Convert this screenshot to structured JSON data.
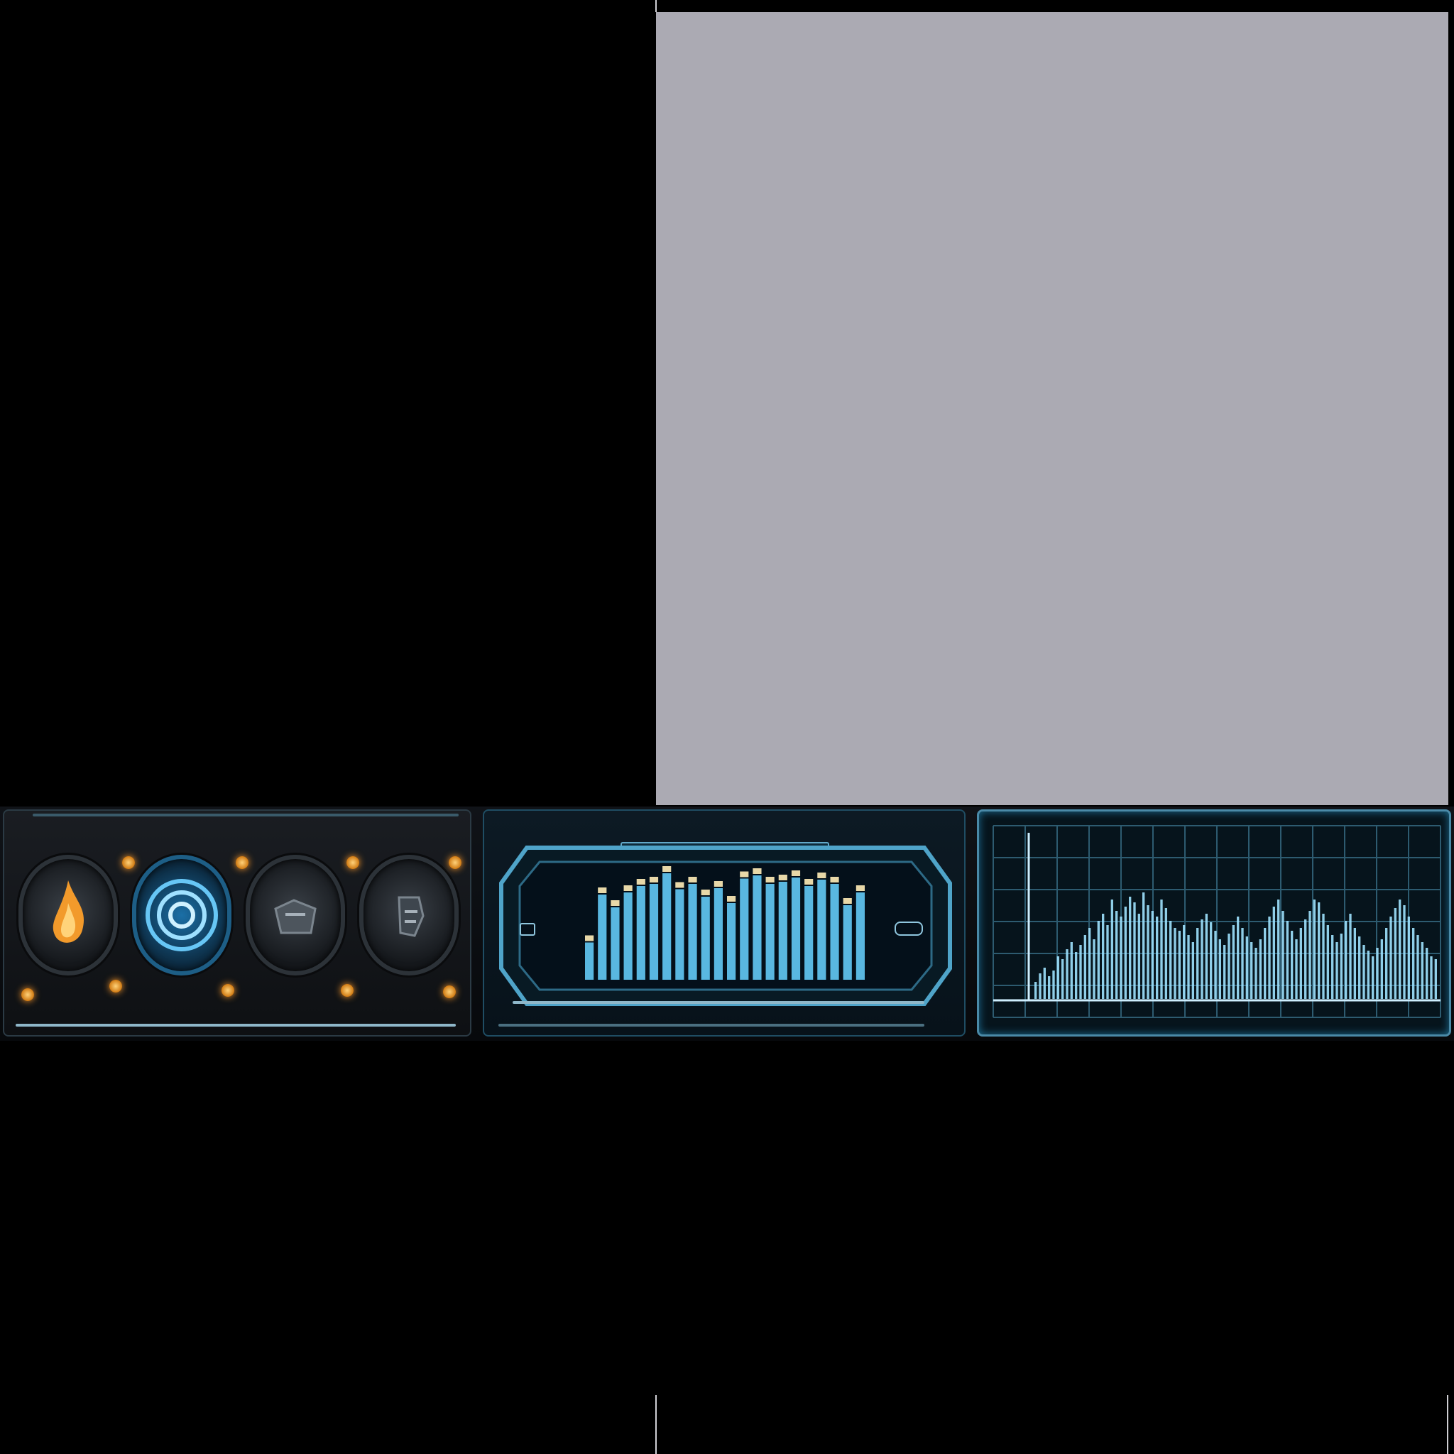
{
  "scene": {
    "background_color": "#000000",
    "viewport_color": "#abaab3"
  },
  "hud": {
    "ability_slots": [
      {
        "name": "fire",
        "icon": "flame-icon",
        "accent": "#ff9a2a"
      },
      {
        "name": "water",
        "icon": "spiral-icon",
        "accent": "#3aa6e8"
      },
      {
        "name": "beast",
        "icon": "claw-icon",
        "accent": "#6e7780"
      },
      {
        "name": "rune",
        "icon": "rune-icon",
        "accent": "#6e7780"
      }
    ],
    "equalizer": {
      "title": "",
      "bar_levels": [
        0.35,
        0.8,
        0.68,
        0.82,
        0.88,
        0.9,
        1.0,
        0.85,
        0.9,
        0.78,
        0.86,
        0.72,
        0.95,
        0.98,
        0.9,
        0.92,
        0.96,
        0.88,
        0.94,
        0.9,
        0.7,
        0.82
      ],
      "bar_color": "#59b7e0",
      "peak_color": "#e8d8a8"
    }
  },
  "chart_data": {
    "type": "bar",
    "title": "",
    "xlabel": "",
    "ylabel": "",
    "grid": true,
    "values": [
      0.12,
      0.18,
      0.22,
      0.16,
      0.2,
      0.3,
      0.28,
      0.35,
      0.4,
      0.33,
      0.38,
      0.45,
      0.5,
      0.42,
      0.55,
      0.6,
      0.52,
      0.7,
      0.62,
      0.58,
      0.65,
      0.72,
      0.68,
      0.6,
      0.75,
      0.66,
      0.62,
      0.58,
      0.7,
      0.64,
      0.55,
      0.5,
      0.48,
      0.52,
      0.45,
      0.4,
      0.5,
      0.56,
      0.6,
      0.54,
      0.48,
      0.42,
      0.38,
      0.46,
      0.52,
      0.58,
      0.5,
      0.44,
      0.4,
      0.36,
      0.42,
      0.5,
      0.58,
      0.65,
      0.7,
      0.62,
      0.55,
      0.48,
      0.42,
      0.5,
      0.56,
      0.62,
      0.7,
      0.68,
      0.6,
      0.52,
      0.45,
      0.4,
      0.46,
      0.55,
      0.6,
      0.5,
      0.44,
      0.38,
      0.34,
      0.3,
      0.36,
      0.42,
      0.5,
      0.58,
      0.64,
      0.7,
      0.66,
      0.58,
      0.5,
      0.45,
      0.4,
      0.36,
      0.3,
      0.28
    ],
    "bar_color": "#9fe2ff"
  }
}
